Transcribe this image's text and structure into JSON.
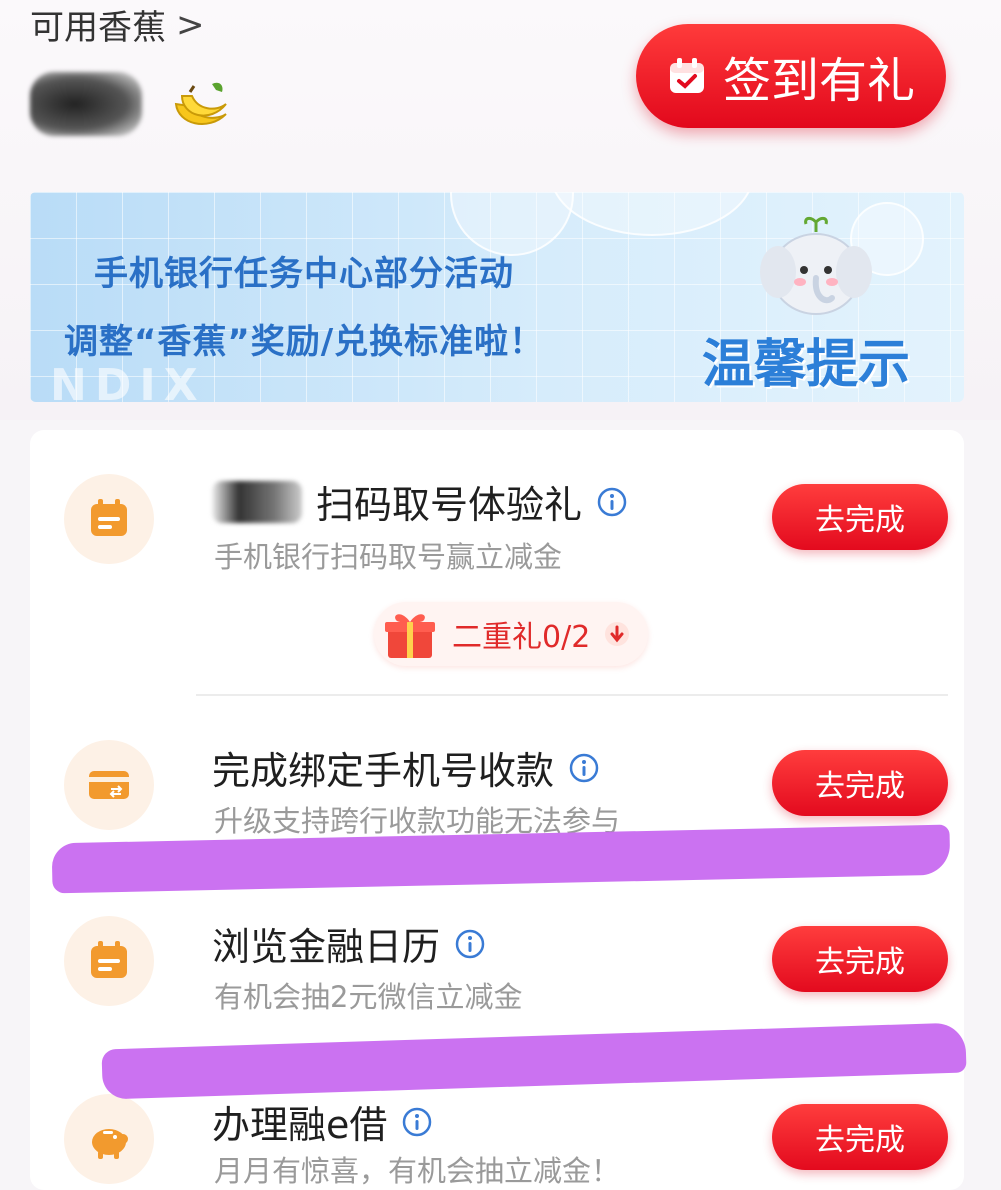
{
  "header": {
    "balance_label": "可用香蕉",
    "balance_chevron": ">",
    "checkin_label": "签到有礼"
  },
  "banner": {
    "line1": "手机银行任务中心部分活动",
    "line2": "调整“香蕉”奖励/兑换标准啦！",
    "title": "温馨提示",
    "deco_text": "NDIX"
  },
  "tasks": [
    {
      "title": "扫码取号体验礼",
      "subtitle": "手机银行扫码取号赢立减金",
      "button": "去完成",
      "icon": "calendar-icon",
      "reward": "二重礼0/2"
    },
    {
      "title": "完成绑定手机号收款",
      "subtitle": "升级支持跨行收款功能无法参与",
      "button": "去完成",
      "icon": "card-transfer-icon"
    },
    {
      "title": "浏览金融日历",
      "subtitle": "有机会抽2元微信立减金",
      "button": "去完成",
      "icon": "calendar-icon"
    },
    {
      "title": "办理融e借",
      "subtitle": "月月有惊喜，有机会抽立减金！",
      "button": "去完成",
      "icon": "piggy-bank-icon"
    }
  ],
  "colors": {
    "accent_red": "#e30a1e",
    "icon_orange": "#f29a2e",
    "banner_blue": "#2a70c6",
    "scribble_purple": "#c86af0"
  }
}
